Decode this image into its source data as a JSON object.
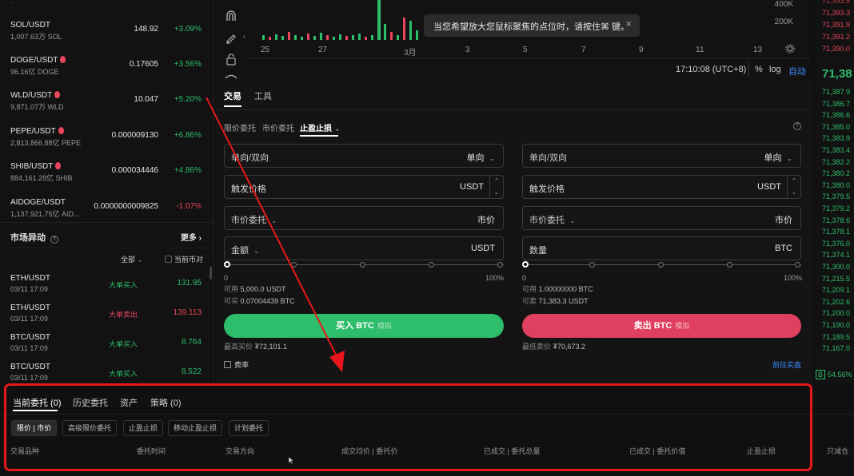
{
  "markets": [
    {
      "symbol": "SOL/USDT",
      "hot": false,
      "volume": "1,007.63万 SOL",
      "price": "148.92",
      "change": "+3.09%",
      "dir": "up"
    },
    {
      "symbol": "DOGE/USDT",
      "hot": true,
      "volume": "96.16亿 DOGE",
      "price": "0.17605",
      "change": "+3.56%",
      "dir": "up"
    },
    {
      "symbol": "WLD/USDT",
      "hot": true,
      "volume": "9,871.07万 WLD",
      "price": "10.047",
      "change": "+5.20%",
      "dir": "up"
    },
    {
      "symbol": "PEPE/USDT",
      "hot": true,
      "volume": "2,813,866.88亿 PEPE",
      "price": "0.000009130",
      "change": "+6.86%",
      "dir": "up"
    },
    {
      "symbol": "SHIB/USDT",
      "hot": true,
      "volume": "884,161.28亿 SHIB",
      "price": "0.000034446",
      "change": "+4.86%",
      "dir": "up"
    },
    {
      "symbol": "AIDOGE/USDT",
      "hot": false,
      "volume": "1,137,921.75亿 AID...",
      "price": "0.0000000009825",
      "change": "-1.07%",
      "dir": "down"
    }
  ],
  "anomaly": {
    "title": "市场异动",
    "more": "更多",
    "filter": "全部",
    "current_only": "当前币对",
    "rows": [
      {
        "symbol": "ETH/USDT",
        "time": "03/11 17:09",
        "type": "大单买入",
        "value": "131.95",
        "dir": "up"
      },
      {
        "symbol": "ETH/USDT",
        "time": "03/11 17:09",
        "type": "大单卖出",
        "value": "139.113",
        "dir": "down"
      },
      {
        "symbol": "BTC/USDT",
        "time": "03/11 17:09",
        "type": "大单买入",
        "value": "8.764",
        "dir": "up"
      },
      {
        "symbol": "BTC/USDT",
        "time": "03/11 17:09",
        "type": "大单买入",
        "value": "8.522",
        "dir": "up"
      }
    ]
  },
  "chart": {
    "y_labels": [
      "400K",
      "200K"
    ],
    "x_labels": [
      "25",
      "27",
      "3月",
      "3",
      "5",
      "7",
      "9",
      "11",
      "13"
    ],
    "tooltip": "当您希望放大您鼠标聚焦的点位时，请按住⌘ 键。",
    "clock": "17:10:08 (UTC+8)",
    "percent": "%",
    "log": "log",
    "auto": "自动"
  },
  "orderbook": {
    "asks": [
      "71,393.3",
      "71,391.9",
      "71,391.2",
      "71,390.0"
    ],
    "last": "71,38",
    "bids": [
      "71,387.9",
      "71,386.7",
      "71,386.6",
      "71,385.0",
      "71,383.9",
      "71,383.4",
      "71,382.2",
      "71,380.2",
      "71,380.0",
      "71,379.5",
      "71,379.2",
      "71,378.6",
      "71,378.1",
      "71,376.0",
      "71,374.1",
      "71,300.0",
      "71,215.5",
      "71,209.1",
      "71,202.6",
      "71,200.0",
      "71,190.0",
      "71,189.5",
      "71,167.0"
    ],
    "ratio_label": "B",
    "ratio": "54.56%"
  },
  "trade": {
    "tabs": [
      "交易",
      "工具"
    ],
    "order_types": [
      "限价委托",
      "市价委托",
      "止盈止损"
    ],
    "buy": {
      "mode_label": "单向/双向",
      "mode_value": "单向",
      "trigger_label": "触发价格",
      "trigger_unit": "USDT",
      "order_label": "市价委托",
      "order_value": "市价",
      "amount_label": "金额",
      "amount_unit": "USDT",
      "slider_min": "0",
      "slider_max": "100%",
      "available_label": "可用",
      "available": "5,000.0 USDT",
      "can_label": "可买",
      "can": "0.07004439 BTC",
      "button": "买入 BTC",
      "button_tag": "模拟",
      "limit_label": "最高买价",
      "limit": "₮72,101.1"
    },
    "sell": {
      "mode_label": "单向/双向",
      "mode_value": "单向",
      "trigger_label": "触发价格",
      "trigger_unit": "USDT",
      "order_label": "市价委托",
      "order_value": "市价",
      "amount_label": "数量",
      "amount_unit": "BTC",
      "slider_min": "0",
      "slider_max": "100%",
      "available_label": "可用",
      "available": "1.00000000 BTC",
      "can_label": "可卖",
      "can": "71,383.3 USDT",
      "button": "卖出 BTC",
      "button_tag": "模拟",
      "limit_label": "最低卖价",
      "limit": "₮70,673.2"
    },
    "fee": "费率",
    "go_real": "前往实盘"
  },
  "bottom": {
    "tabs": [
      "当前委托 (0)",
      "历史委托",
      "资产",
      "策略 (0)"
    ],
    "chips": [
      "限价 | 市价",
      "高级限价委托",
      "止盈止损",
      "移动止盈止损",
      "计划委托"
    ],
    "columns": [
      "交易品种",
      "委托时间",
      "交易方向",
      "成交均价 | 委托价",
      "已成交 | 委托总量",
      "已成交 | 委托价值",
      "止盈止损",
      "只减仓"
    ]
  },
  "colors": {
    "up": "#2ebd6b",
    "down": "#e8465c",
    "buy": "#2ebd6b",
    "sell": "#e0405f",
    "highlight": "#e8171b",
    "link": "#3d8bfd"
  }
}
